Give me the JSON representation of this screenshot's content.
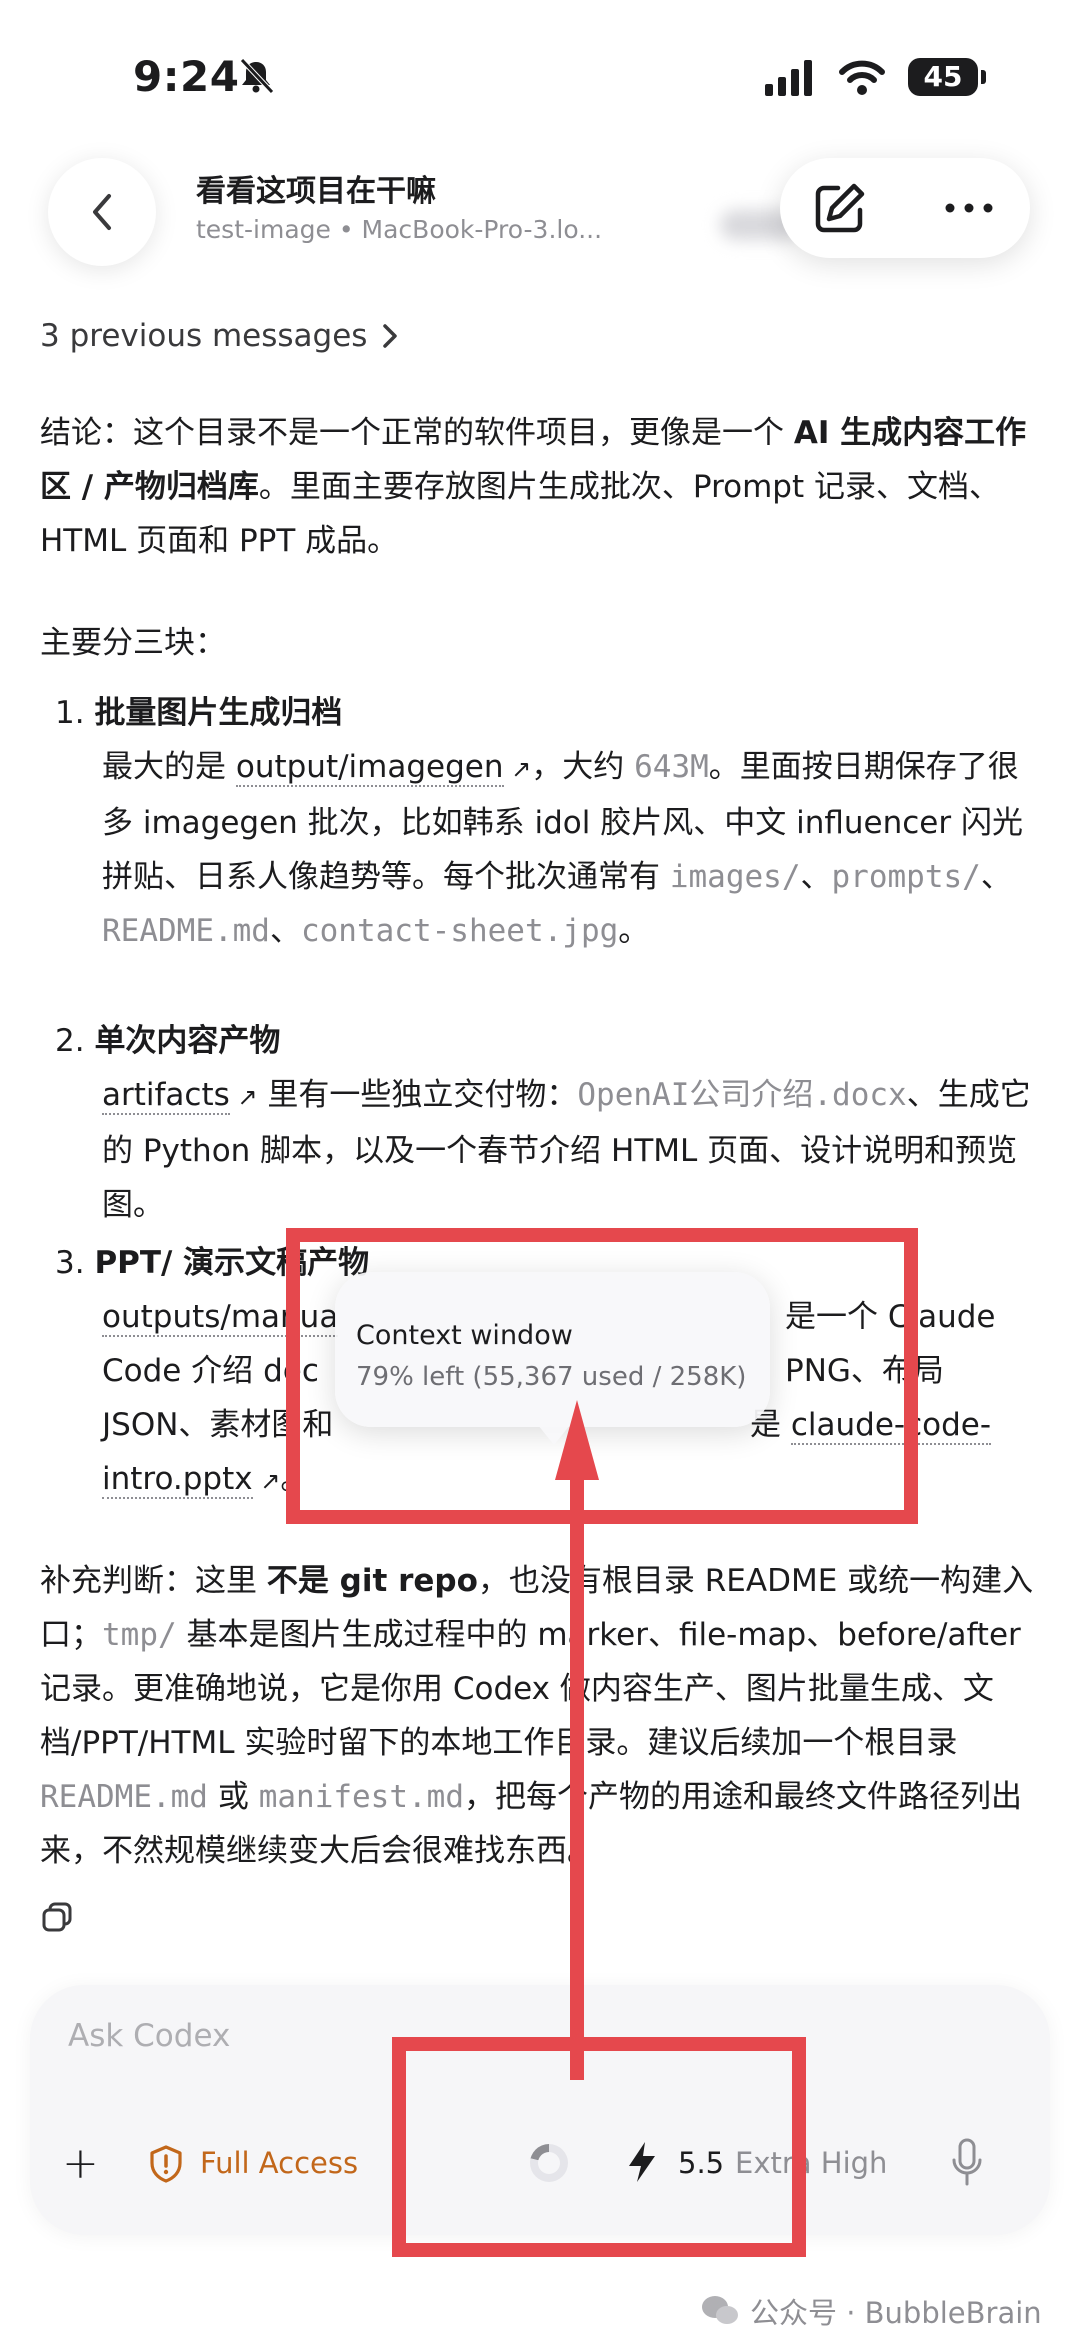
{
  "status_bar": {
    "time": "9:24",
    "battery": "45",
    "icons": [
      "bell-slash-icon",
      "cellular-signal-icon",
      "wifi-icon",
      "battery-icon"
    ]
  },
  "header": {
    "back_icon": "chevron-left-icon",
    "title": "看看这项目在干嘛",
    "subtitle": "test-image • MacBook-Pro-3.lo...",
    "edit_icon": "compose-icon",
    "more_icon": "ellipsis-icon"
  },
  "previous_messages": "3 previous messages",
  "message": {
    "intro_a": "结论：这个目录不是一个正常的软件项目，更像是一个 ",
    "intro_b": "AI 生成内容工作区 / 产物归档库",
    "intro_c": "。里面主要存放图片生成批次、Prompt 记录、文档、HTML 页面和 PPT 成品。",
    "sections_label": "主要分三块：",
    "items": [
      {
        "num": "1.",
        "title": "批量图片生成归档",
        "p1": "最大的是 ",
        "link": "output/imagegen",
        "p2": "，大约 ",
        "size": "643M",
        "p3": "。里面按日期保存了很多 imagegen 批次，比如韩系 idol 胶片风、中文 influencer 闪光拼贴、日系人像趋势等。每个批次通常有 ",
        "code1": "images/",
        "sep1": "、",
        "code2": "prompts/",
        "sep2": "、",
        "code3": "README.md",
        "sep3": "、",
        "code4": "contact-sheet.jpg",
        "end": "。"
      },
      {
        "num": "2.",
        "title": "单次内容产物",
        "link": "artifacts",
        "p1": " 里有一些独立交付物：",
        "code1": "OpenAI公司介绍.docx",
        "p2": "、生成它的 Python 脚本，以及一个春节介绍 HTML 页面、设计说明和预览图。"
      },
      {
        "num": "3.",
        "title": "PPT/ 演示文稿产物",
        "link": "outputs/manua",
        "p1": "是一个 Claude",
        "p2": "Code 介绍 dec",
        "p3": "PNG、布局",
        "p4": "JSON、素材图和",
        "p5": "是 ",
        "link2": "claude-code-intro.pptx",
        "end": "。"
      }
    ],
    "extra_a": "补充判断：这里 ",
    "extra_b": "不是 git repo",
    "extra_c": "，也没有根目录 README 或统一构建入口；",
    "extra_code1": "tmp/",
    "extra_d": " 基本是图片生成过程中的 marker、file-map、before/after 记录。更准确地说，它是你用 Codex 做内容生产、图片批量生成、文档/PPT/HTML 实验时留下的本地工作目录。建议后续加一个根目录 ",
    "extra_code2": "README.md",
    "extra_e": " 或 ",
    "extra_code3": "manifest.md",
    "extra_f": "，把每个产物的用途和最终文件路径列出来，不然规模继续变大后会很难找东西。"
  },
  "tooltip": {
    "title": "Context window",
    "detail": "79% left (55,367 used / 258K)",
    "percent_left": 79
  },
  "composer": {
    "placeholder": "Ask Codex",
    "access_label": "Full Access",
    "model": "5.5",
    "effort": "Extra High",
    "icons": [
      "plus-icon",
      "shield-alert-icon",
      "context-ring-icon",
      "bolt-icon",
      "microphone-icon"
    ]
  },
  "watermark": "公众号 · BubbleBrain",
  "colors": {
    "annotation_red": "#e5484d",
    "access_orange": "#c2671a"
  }
}
